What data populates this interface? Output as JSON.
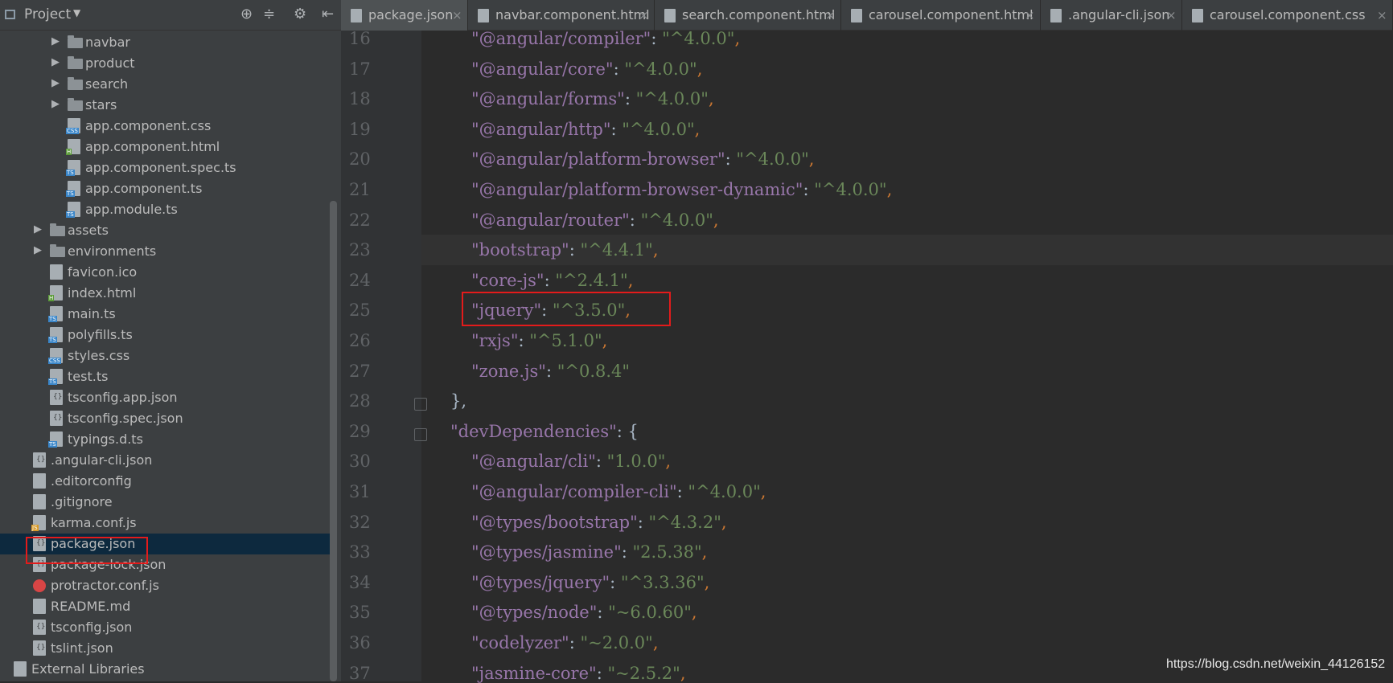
{
  "project": {
    "title": "Project"
  },
  "tree": [
    {
      "label": "navbar",
      "type": "folder",
      "expandable": true
    },
    {
      "label": "product",
      "type": "folder",
      "expandable": true
    },
    {
      "label": "search",
      "type": "folder",
      "expandable": true
    },
    {
      "label": "stars",
      "type": "folder",
      "expandable": true
    },
    {
      "label": "app.component.css",
      "type": "css"
    },
    {
      "label": "app.component.html",
      "type": "html"
    },
    {
      "label": "app.component.spec.ts",
      "type": "ts"
    },
    {
      "label": "app.component.ts",
      "type": "ts"
    },
    {
      "label": "app.module.ts",
      "type": "ts"
    },
    {
      "label": "assets",
      "type": "folder",
      "expandable": true
    },
    {
      "label": "environments",
      "type": "folder",
      "expandable": true
    },
    {
      "label": "favicon.ico",
      "type": "file"
    },
    {
      "label": "index.html",
      "type": "html"
    },
    {
      "label": "main.ts",
      "type": "ts"
    },
    {
      "label": "polyfills.ts",
      "type": "ts"
    },
    {
      "label": "styles.css",
      "type": "css"
    },
    {
      "label": "test.ts",
      "type": "ts"
    },
    {
      "label": "tsconfig.app.json",
      "type": "json"
    },
    {
      "label": "tsconfig.spec.json",
      "type": "json"
    },
    {
      "label": "typings.d.ts",
      "type": "ts"
    },
    {
      "label": ".angular-cli.json",
      "type": "json"
    },
    {
      "label": ".editorconfig",
      "type": "file"
    },
    {
      "label": ".gitignore",
      "type": "file"
    },
    {
      "label": "karma.conf.js",
      "type": "js"
    },
    {
      "label": "package.json",
      "type": "json",
      "selected": true
    },
    {
      "label": "package-lock.json",
      "type": "json"
    },
    {
      "label": "protractor.conf.js",
      "type": "red"
    },
    {
      "label": "README.md",
      "type": "file"
    },
    {
      "label": "tsconfig.json",
      "type": "json"
    },
    {
      "label": "tslint.json",
      "type": "json"
    },
    {
      "label": "External Libraries",
      "type": "lib"
    }
  ],
  "tabs": [
    {
      "label": "package.json",
      "active": true
    },
    {
      "label": "navbar.component.html"
    },
    {
      "label": "search.component.html"
    },
    {
      "label": "carousel.component.html"
    },
    {
      "label": ".angular-cli.json"
    },
    {
      "label": "carousel.component.css"
    }
  ],
  "code": [
    {
      "n": "16",
      "key": "\"@angular/compiler\"",
      "val": "\"^4.0.0\"",
      "comma": ","
    },
    {
      "n": "17",
      "key": "\"@angular/core\"",
      "val": "\"^4.0.0\"",
      "comma": ","
    },
    {
      "n": "18",
      "key": "\"@angular/forms\"",
      "val": "\"^4.0.0\"",
      "comma": ","
    },
    {
      "n": "19",
      "key": "\"@angular/http\"",
      "val": "\"^4.0.0\"",
      "comma": ","
    },
    {
      "n": "20",
      "key": "\"@angular/platform-browser\"",
      "val": "\"^4.0.0\"",
      "comma": ","
    },
    {
      "n": "21",
      "key": "\"@angular/platform-browser-dynamic\"",
      "val": "\"^4.0.0\"",
      "comma": ","
    },
    {
      "n": "22",
      "key": "\"@angular/router\"",
      "val": "\"^4.0.0\"",
      "comma": ","
    },
    {
      "n": "23",
      "key": "\"bootstrap\"",
      "val": "\"^4.4.1\"",
      "comma": ","
    },
    {
      "n": "24",
      "key": "\"core-js\"",
      "val": "\"^2.4.1\"",
      "comma": ","
    },
    {
      "n": "25",
      "key": "\"jquery\"",
      "val": "\"^3.5.0\"",
      "comma": ","
    },
    {
      "n": "26",
      "key": "\"rxjs\"",
      "val": "\"^5.1.0\"",
      "comma": ","
    },
    {
      "n": "27",
      "key": "\"zone.js\"",
      "val": "\"^0.8.4\"",
      "comma": ""
    },
    {
      "n": "28",
      "brace": "},"
    },
    {
      "n": "29",
      "key": "\"devDependencies\"",
      "open": "{"
    },
    {
      "n": "30",
      "key": "\"@angular/cli\"",
      "val": "\"1.0.0\"",
      "comma": ","
    },
    {
      "n": "31",
      "key": "\"@angular/compiler-cli\"",
      "val": "\"^4.0.0\"",
      "comma": ","
    },
    {
      "n": "32",
      "key": "\"@types/bootstrap\"",
      "val": "\"^4.3.2\"",
      "comma": ","
    },
    {
      "n": "33",
      "key": "\"@types/jasmine\"",
      "val": "\"2.5.38\"",
      "comma": ","
    },
    {
      "n": "34",
      "key": "\"@types/jquery\"",
      "val": "\"^3.3.36\"",
      "comma": ","
    },
    {
      "n": "35",
      "key": "\"@types/node\"",
      "val": "\"~6.0.60\"",
      "comma": ","
    },
    {
      "n": "36",
      "key": "\"codelyzer\"",
      "val": "\"~2.0.0\"",
      "comma": ","
    },
    {
      "n": "37",
      "key": "\"jasmine-core\"",
      "val": "\"~2.5.2\"",
      "comma": ","
    }
  ],
  "watermark": "https://blog.csdn.net/weixin_44126152"
}
